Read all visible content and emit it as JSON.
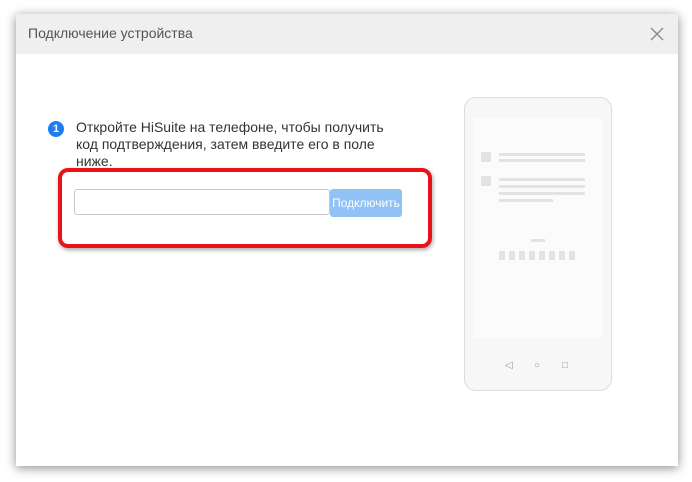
{
  "dialog": {
    "title": "Подключение устройства",
    "close_icon": "close-icon"
  },
  "step": {
    "number": "1",
    "instruction": "Откройте HiSuite на телефоне, чтобы получить код подтверждения, затем введите его в поле ниже."
  },
  "form": {
    "code_value": "",
    "code_placeholder": "",
    "connect_label": "Подключить"
  },
  "phone_nav": {
    "back": "◁",
    "home": "○",
    "recent": "□"
  },
  "colors": {
    "accent": "#1e7ef0",
    "button_disabled": "#90c2f6",
    "highlight": "#e8131a"
  }
}
